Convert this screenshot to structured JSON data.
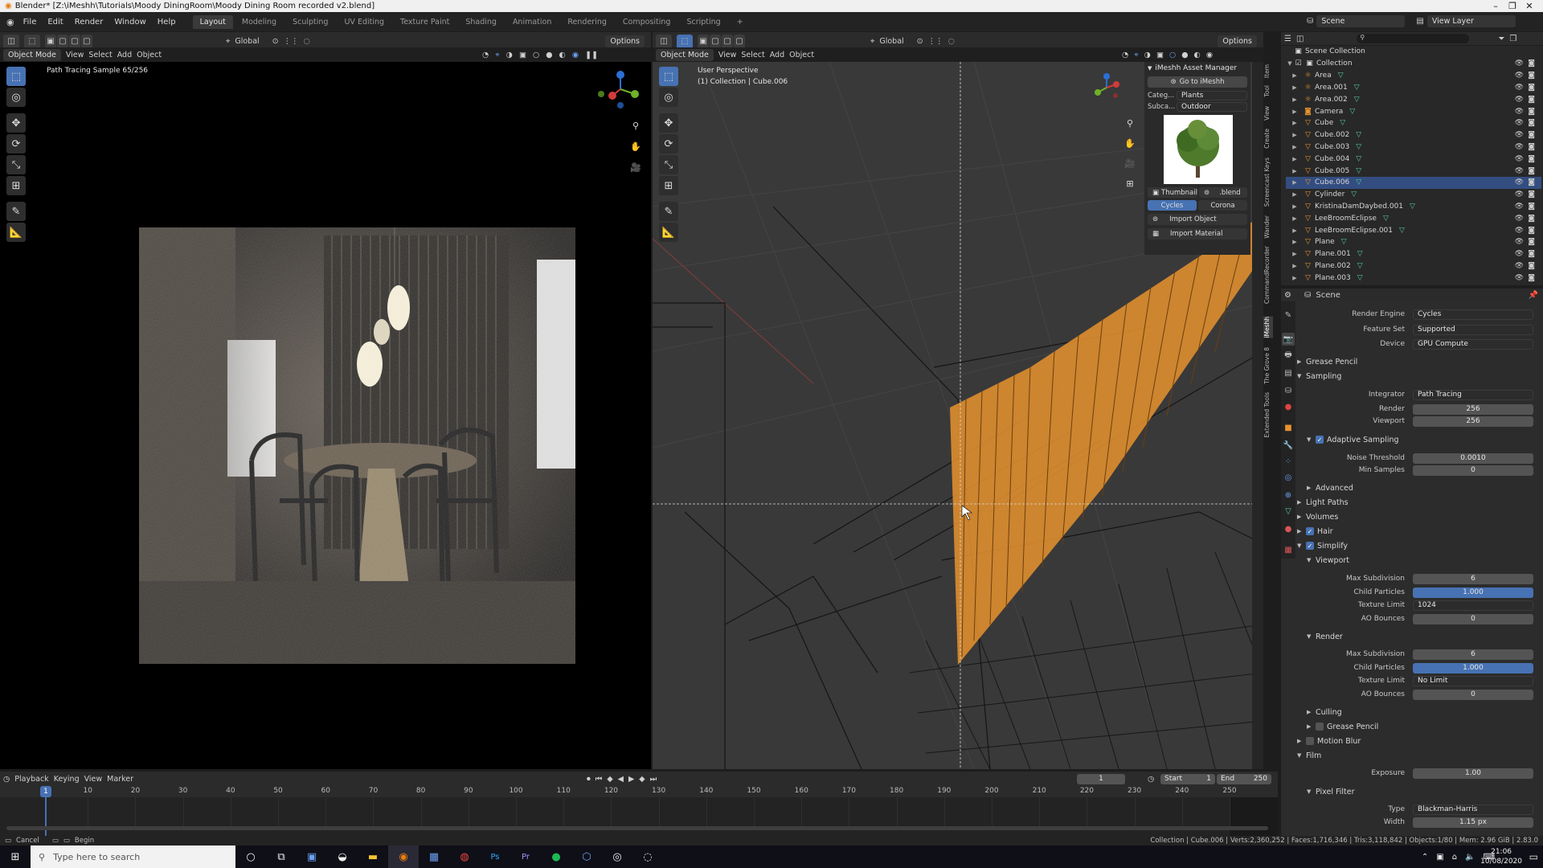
{
  "window": {
    "title": "Blender* [Z:\\iMeshh\\Tutorials\\Moody DiningRoom\\Moody Dining Room recorded v2.blend]"
  },
  "menu": [
    "File",
    "Edit",
    "Render",
    "Window",
    "Help"
  ],
  "workspaces": [
    "Layout",
    "Modeling",
    "Sculpting",
    "UV Editing",
    "Texture Paint",
    "Shading",
    "Animation",
    "Rendering",
    "Compositing",
    "Scripting"
  ],
  "workspace_active": "Layout",
  "scene": {
    "name": "Scene",
    "view_layer": "View Layer"
  },
  "left_view": {
    "mode": "Object Mode",
    "menus": [
      "View",
      "Select",
      "Add",
      "Object"
    ],
    "transform": "Global",
    "options": "Options",
    "status": "Path Tracing Sample 65/256"
  },
  "right_view": {
    "mode": "Object Mode",
    "menus": [
      "View",
      "Select",
      "Add",
      "Object"
    ],
    "transform": "Global",
    "options": "Options",
    "perspective": "User Perspective",
    "collection": "(1) Collection | Cube.006"
  },
  "imeshh": {
    "title": "iMeshh Asset Manager",
    "go_to": "Go to iMeshh",
    "category_label": "Categ...",
    "category_value": "Plants",
    "subcat_label": "Subca...",
    "subcat_value": "Outdoor",
    "thumbnail": "Thumbnail",
    "blend": ".blend",
    "cycles": "Cycles",
    "corona": "Corona",
    "import_object": "Import Object",
    "import_material": "Import Material"
  },
  "side_tabs": [
    "Item",
    "Tool",
    "View",
    "Create",
    "Screencast Keys",
    "Wander",
    "CommandRecorder",
    "iMeshh",
    "The Grove 8",
    "Extended Tools"
  ],
  "outliner": {
    "root": "Scene Collection",
    "collection": "Collection",
    "items": [
      {
        "name": "Area",
        "icon": "light-icon"
      },
      {
        "name": "Area.001",
        "icon": "light-icon"
      },
      {
        "name": "Area.002",
        "icon": "light-icon"
      },
      {
        "name": "Camera",
        "icon": "camera-icon"
      },
      {
        "name": "Cube",
        "icon": "mesh-icon"
      },
      {
        "name": "Cube.002",
        "icon": "mesh-icon"
      },
      {
        "name": "Cube.003",
        "icon": "mesh-icon"
      },
      {
        "name": "Cube.004",
        "icon": "mesh-icon"
      },
      {
        "name": "Cube.005",
        "icon": "mesh-icon"
      },
      {
        "name": "Cube.006",
        "icon": "mesh-icon",
        "selected": true
      },
      {
        "name": "Cylinder",
        "icon": "mesh-icon"
      },
      {
        "name": "KristinaDamDaybed.001",
        "icon": "mesh-icon"
      },
      {
        "name": "LeeBroomEclipse",
        "icon": "mesh-icon"
      },
      {
        "name": "LeeBroomEclipse.001",
        "icon": "mesh-icon"
      },
      {
        "name": "Plane",
        "icon": "mesh-icon"
      },
      {
        "name": "Plane.001",
        "icon": "mesh-icon"
      },
      {
        "name": "Plane.002",
        "icon": "mesh-icon"
      },
      {
        "name": "Plane.003",
        "icon": "mesh-icon"
      }
    ]
  },
  "properties": {
    "context": "Scene",
    "render_engine_label": "Render Engine",
    "render_engine": "Cycles",
    "feature_set_label": "Feature Set",
    "feature_set": "Supported",
    "device_label": "Device",
    "device": "GPU Compute",
    "grease_pencil": "Grease Pencil",
    "sampling": "Sampling",
    "integrator_label": "Integrator",
    "integrator": "Path Tracing",
    "render_label": "Render",
    "render_samples": "256",
    "viewport_label": "Viewport",
    "viewport_samples": "256",
    "adaptive_sampling": "Adaptive Sampling",
    "noise_threshold_label": "Noise Threshold",
    "noise_threshold": "0.0010",
    "min_samples_label": "Min Samples",
    "min_samples": "0",
    "advanced": "Advanced",
    "light_paths": "Light Paths",
    "volumes": "Volumes",
    "hair": "Hair",
    "simplify": "Simplify",
    "simplify_viewport": "Viewport",
    "max_subdiv_label": "Max Subdivision",
    "vp_max_subdiv": "6",
    "child_particles_label": "Child Particles",
    "vp_child_particles": "1.000",
    "texture_limit_label": "Texture Limit",
    "vp_texture_limit": "1024",
    "ao_bounces_label": "AO Bounces",
    "vp_ao_bounces": "0",
    "simplify_render": "Render",
    "r_max_subdiv": "6",
    "r_child_particles": "1.000",
    "r_texture_limit": "No Limit",
    "r_ao_bounces": "0",
    "culling": "Culling",
    "culling_grease_pencil": "Grease Pencil",
    "motion_blur": "Motion Blur",
    "film": "Film",
    "exposure_label": "Exposure",
    "exposure": "1.00",
    "pixel_filter": "Pixel Filter",
    "type_label": "Type",
    "type": "Blackman-Harris",
    "width_label": "Width",
    "width": "1.15 px"
  },
  "timeline": {
    "menus": [
      "Playback",
      "Keying",
      "View",
      "Marker"
    ],
    "current_frame": "1",
    "start_label": "Start",
    "start": "1",
    "end_label": "End",
    "end": "250",
    "ticks": [
      "1",
      "10",
      "20",
      "30",
      "40",
      "50",
      "60",
      "70",
      "80",
      "90",
      "100",
      "110",
      "120",
      "130",
      "140",
      "150",
      "160",
      "170",
      "180",
      "190",
      "200",
      "210",
      "220",
      "230",
      "240",
      "250"
    ]
  },
  "statusbar": {
    "cancel": "Cancel",
    "begin": "Begin",
    "stats": "Collection | Cube.006 | Verts:2,360,252 | Faces:1,716,346 | Tris:3,118,842 | Objects:1/80 | Mem: 2.96 GiB | 2.83.0"
  },
  "taskbar": {
    "search_placeholder": "Type here to search",
    "time": "21:06",
    "date": "10/08/2020"
  },
  "colors": {
    "accent": "#4772b3",
    "selected_orange": "#e8932e"
  }
}
